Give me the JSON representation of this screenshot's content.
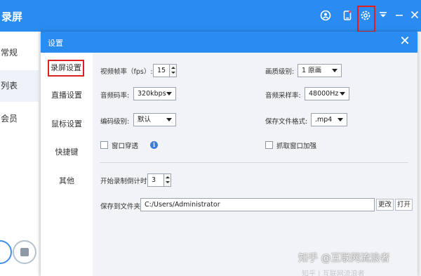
{
  "app": {
    "title": "录屏",
    "topbar_icons": [
      "user-circle-icon",
      "phone-icon",
      "gear-icon",
      "dropdown-icon",
      "minimize-icon",
      "close-icon"
    ],
    "sidebar": [
      "常规",
      "列表",
      "会员"
    ]
  },
  "dialog": {
    "title": "设置",
    "close": "✕",
    "nav": [
      "录屏设置",
      "直播设置",
      "鼠标设置",
      "快捷键",
      "其他"
    ],
    "active_nav": "录屏设置"
  },
  "form": {
    "fps_label": "视频帧率（fps）:",
    "fps_value": "15",
    "quality_label": "画质级别:",
    "quality_value": "1 原画",
    "audio_bitrate_label": "音频码率:",
    "audio_bitrate_value": "320kbps",
    "sample_rate_label": "音频采样率:",
    "sample_rate_value": "48000Hz",
    "codec_label": "编码级别:",
    "codec_value": "默认",
    "format_label": "保存文件格式:",
    "format_value": ".mp4",
    "window_pierce_label": "窗口穿透",
    "capture_window_label": "抓取窗口加强",
    "countdown_label": "开始录制倒计时:",
    "countdown_value": "3",
    "save_path_label": "保存到文件夹:",
    "save_path_value": "C:/Users/Administrator",
    "change_button": "更改",
    "open_button": "打开"
  },
  "watermark": {
    "text": "知乎 @互联网流浪者",
    "sub": "知乎 | 互联网流浪者"
  },
  "colors": {
    "accent": "#2a8cf0",
    "highlight": "#e02020",
    "panel": "#f1f3f6"
  }
}
